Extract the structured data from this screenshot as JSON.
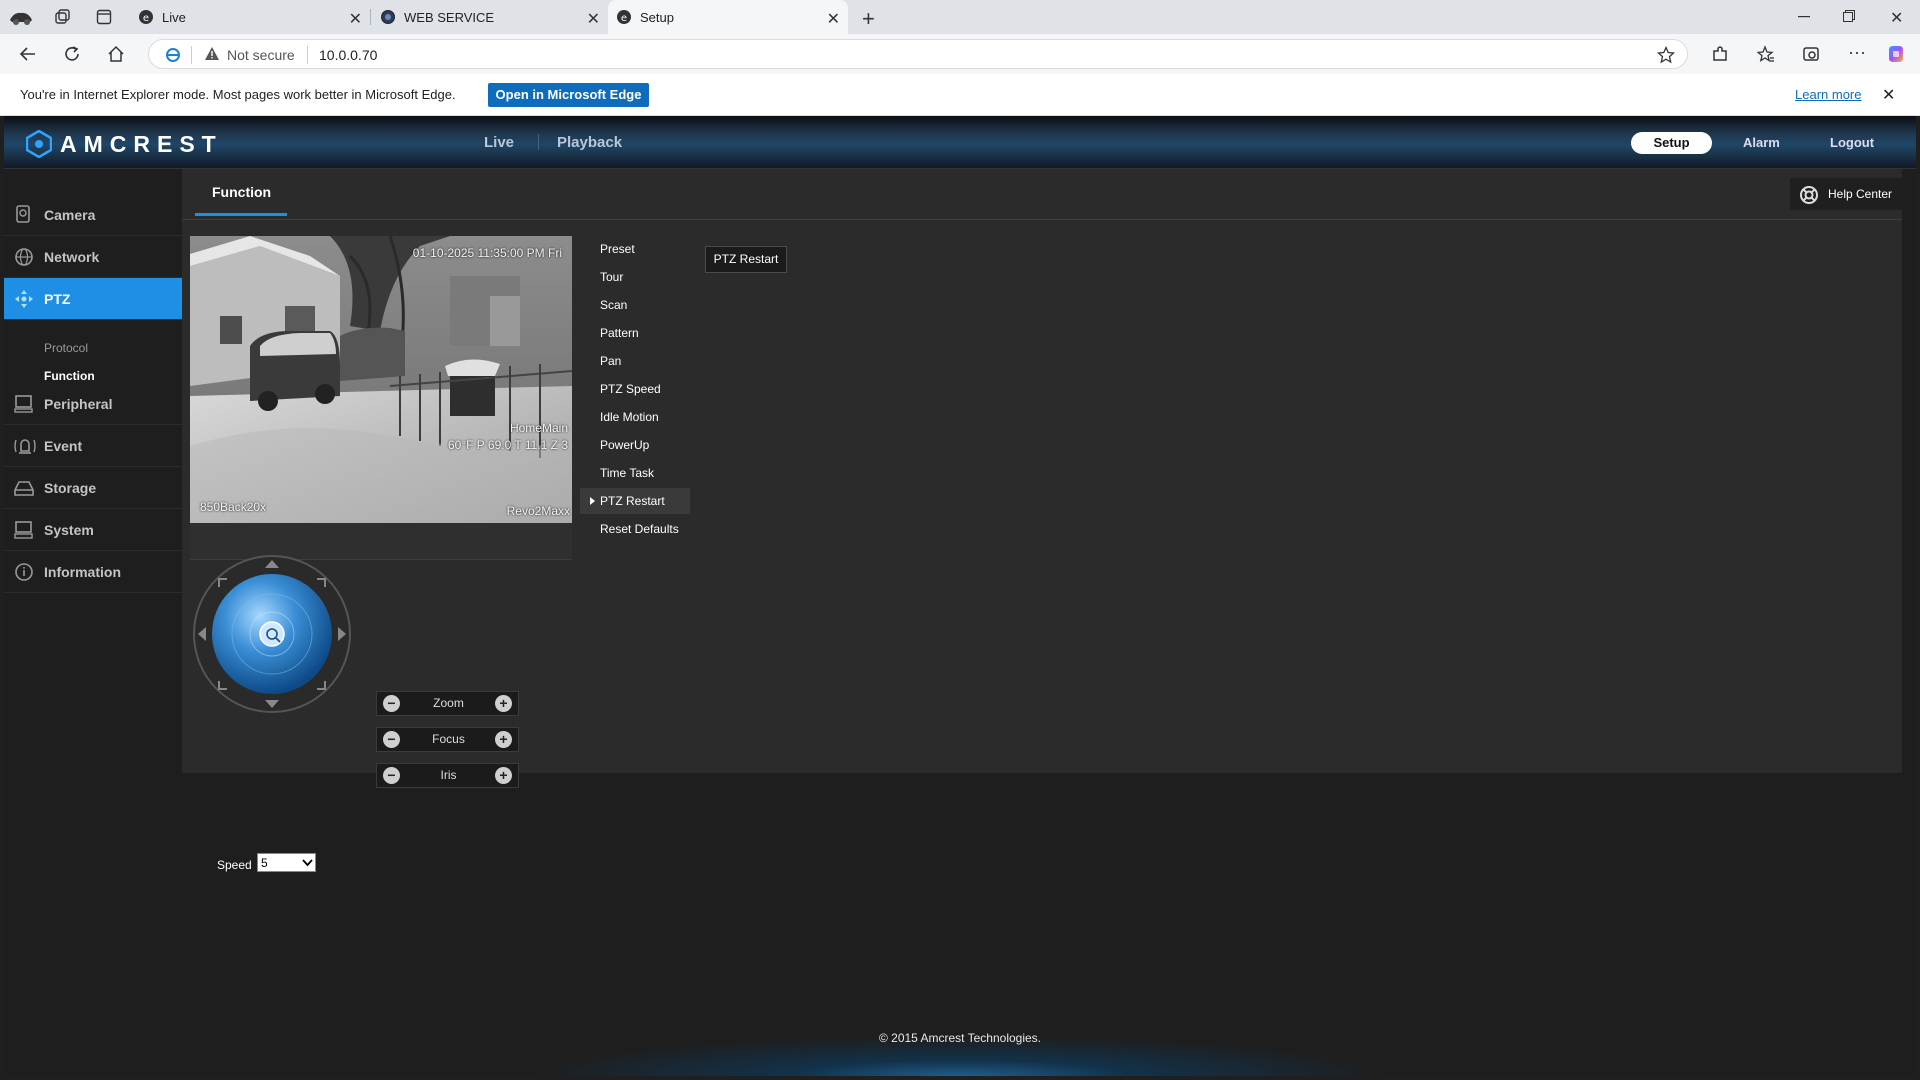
{
  "browser": {
    "tabs": [
      {
        "label": "Live",
        "active": false
      },
      {
        "label": "WEB SERVICE",
        "active": false
      },
      {
        "label": "Setup",
        "active": true
      }
    ],
    "security_label": "Not secure",
    "url": "10.0.0.70",
    "ie_message": "You're in Internet Explorer mode. Most pages work better in Microsoft Edge.",
    "ie_open_button": "Open in Microsoft Edge",
    "ie_learn_more": "Learn more"
  },
  "app": {
    "logo_text": "AMCREST",
    "accent": "#1f8fe6",
    "top_nav": {
      "live": "Live",
      "playback": "Playback"
    },
    "top_right": {
      "setup": "Setup",
      "alarm": "Alarm",
      "logout": "Logout"
    },
    "sidebar": {
      "items": [
        {
          "label": "Camera",
          "icon": "camera-icon"
        },
        {
          "label": "Network",
          "icon": "globe-icon"
        },
        {
          "label": "PTZ",
          "icon": "ptz-icon",
          "active": true
        },
        {
          "label": "Peripheral",
          "icon": "monitor-icon"
        },
        {
          "label": "Event",
          "icon": "bell-icon"
        },
        {
          "label": "Storage",
          "icon": "storage-icon"
        },
        {
          "label": "System",
          "icon": "system-icon"
        },
        {
          "label": "Information",
          "icon": "info-icon"
        }
      ],
      "ptz_sub": [
        {
          "label": "Protocol",
          "selected": false
        },
        {
          "label": "Function",
          "selected": true
        }
      ]
    },
    "panel": {
      "tab": "Function",
      "help": "Help Center",
      "video": {
        "timestamp": "01-10-2025 11:35:00 PM Fri",
        "camera_name": "HomeMain",
        "stats": "60°F P 69.0 T 11.1 Z 3",
        "bottom_left": "850Back20x",
        "bottom_right": "Revo2Maxx"
      },
      "controls": [
        "Zoom",
        "Focus",
        "Iris"
      ],
      "speed_label": "Speed",
      "speed_value": "5",
      "function_menu": [
        "Preset",
        "Tour",
        "Scan",
        "Pattern",
        "Pan",
        "PTZ Speed",
        "Idle Motion",
        "PowerUp",
        "Time Task",
        "PTZ Restart",
        "Reset Defaults"
      ],
      "function_selected": "PTZ Restart",
      "restart_button": "PTZ Restart"
    },
    "footer": "© 2015 Amcrest Technologies."
  }
}
